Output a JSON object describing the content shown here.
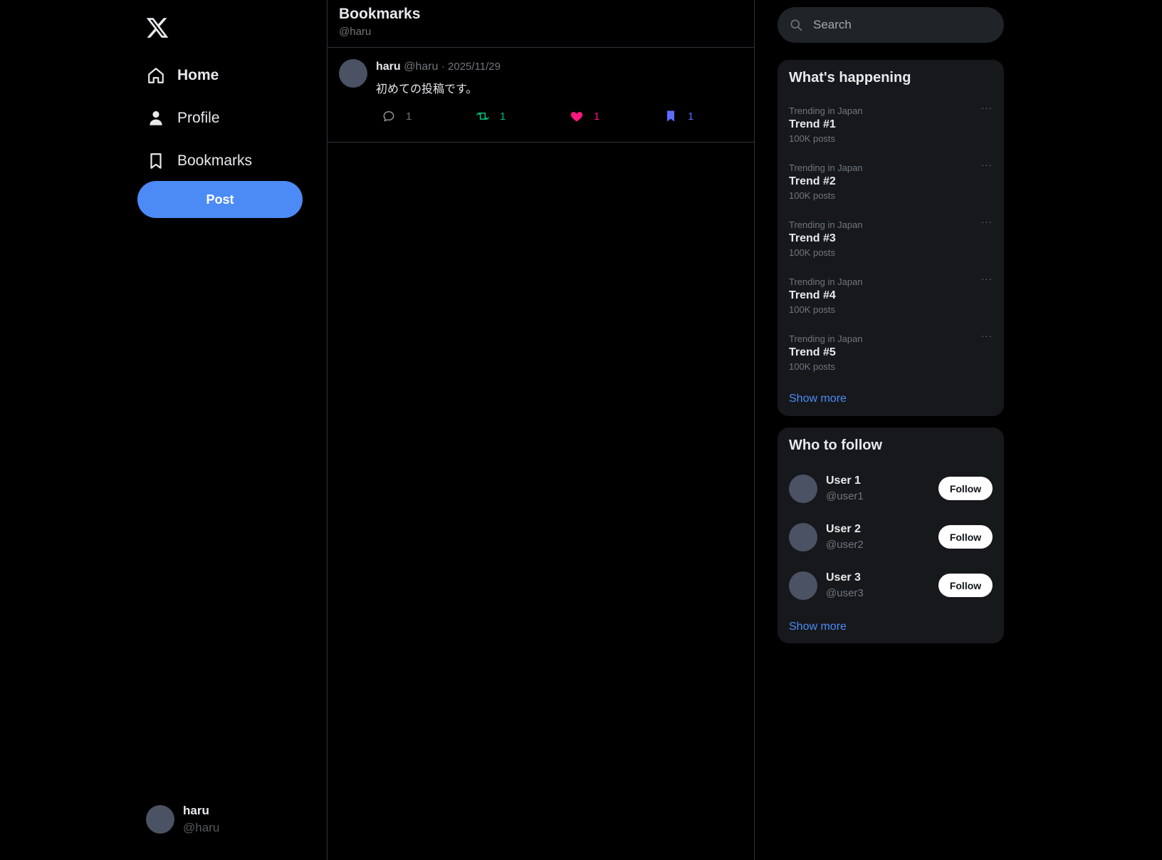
{
  "brand": {
    "logo": "X"
  },
  "nav": {
    "items": [
      {
        "label": "Home",
        "icon": "home-icon",
        "active": true
      },
      {
        "label": "Profile",
        "icon": "person-icon",
        "active": false
      },
      {
        "label": "Bookmarks",
        "icon": "bookmark-icon",
        "active": false
      }
    ],
    "post_label": "Post"
  },
  "current_user": {
    "name": "haru",
    "handle": "@haru"
  },
  "header": {
    "title": "Bookmarks",
    "subtitle": "@haru"
  },
  "tweets": [
    {
      "name": "haru",
      "handle": "@haru",
      "date": "· 2025/11/29",
      "text": "初めての投稿です。",
      "replies": "1",
      "retweets": "1",
      "likes": "1",
      "bookmarks": "1"
    }
  ],
  "search": {
    "placeholder": "Search"
  },
  "trends": {
    "title": "What's happening",
    "items": [
      {
        "context": "Trending in Japan",
        "name": "Trend #1",
        "count": "100K posts"
      },
      {
        "context": "Trending in Japan",
        "name": "Trend #2",
        "count": "100K posts"
      },
      {
        "context": "Trending in Japan",
        "name": "Trend #3",
        "count": "100K posts"
      },
      {
        "context": "Trending in Japan",
        "name": "Trend #4",
        "count": "100K posts"
      },
      {
        "context": "Trending in Japan",
        "name": "Trend #5",
        "count": "100K posts"
      }
    ],
    "more_glyph": "···",
    "show_more": "Show more"
  },
  "who_to_follow": {
    "title": "Who to follow",
    "users": [
      {
        "name": "User 1",
        "handle": "@user1",
        "button": "Follow"
      },
      {
        "name": "User 2",
        "handle": "@user2",
        "button": "Follow"
      },
      {
        "name": "User 3",
        "handle": "@user3",
        "button": "Follow"
      }
    ],
    "show_more": "Show more"
  },
  "colors": {
    "accent": "#4c8bf5",
    "retweet": "#00ba7c",
    "like": "#f91880",
    "bookmark": "#5b6cff",
    "background": "#000000",
    "panel": "#16181c"
  }
}
